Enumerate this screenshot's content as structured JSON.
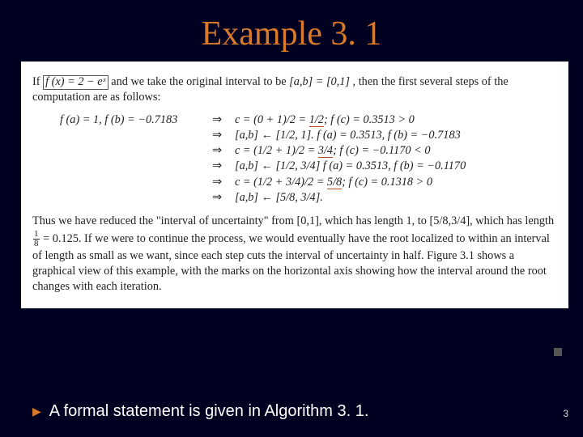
{
  "title": "Example 3. 1",
  "intro": {
    "prefix": "If ",
    "fx": "f (x) = 2 − eˣ",
    "mid": " and we take the original interval to be ",
    "ab": "[a,b] = [0,1]",
    "suffix": ", then the first several steps of the computation are as follows:"
  },
  "initial": "f (a) = 1, f (b) = −0.7183",
  "steps": [
    {
      "left": "",
      "rhs_pre": "c = (0 + 1)/2 = ",
      "rhs_ul": "1/2",
      "rhs_post": "; f (c) = 0.3513 > 0"
    },
    {
      "left": "",
      "rhs_pre": "[a,b] ← [1/2, 1]. f (a) = 0.3513, f (b) = −0.7183",
      "rhs_ul": "",
      "rhs_post": ""
    },
    {
      "left": "",
      "rhs_pre": "c = (1/2 + 1)/2 = ",
      "rhs_ul": "3/4",
      "rhs_post": "; f (c) = −0.1170 < 0"
    },
    {
      "left": "",
      "rhs_pre": "[a,b] ← [1/2, 3/4] f (a) = 0.3513, f (b) = −0.1170",
      "rhs_ul": "",
      "rhs_post": ""
    },
    {
      "left": "",
      "rhs_pre": "c = (1/2 + 3/4)/2 = ",
      "rhs_ul": "5/8",
      "rhs_post": "; f (c) = 0.1318 > 0"
    },
    {
      "left": "",
      "rhs_pre": "[a,b] ← [5/8, 3/4].",
      "rhs_ul": "",
      "rhs_post": ""
    }
  ],
  "para2": {
    "t1": "Thus we have reduced the \"interval of uncertainty\" from [0,1], which has length 1, to [5/8,3/4], which has length ",
    "frac_num": "1",
    "frac_den": "8",
    "t2": " = 0.125.  If we were to continue the process, we would eventually have the root localized to within an interval of length as small as we want, since each step cuts the interval of uncertainty in half.  Figure 3.1 shows a graphical view of this example, with the marks on the horizontal axis showing how the interval around the root changes with each iteration."
  },
  "bullet": "A formal statement is given in Algorithm 3. 1.",
  "arrow": "⇒",
  "pagenum": "3"
}
